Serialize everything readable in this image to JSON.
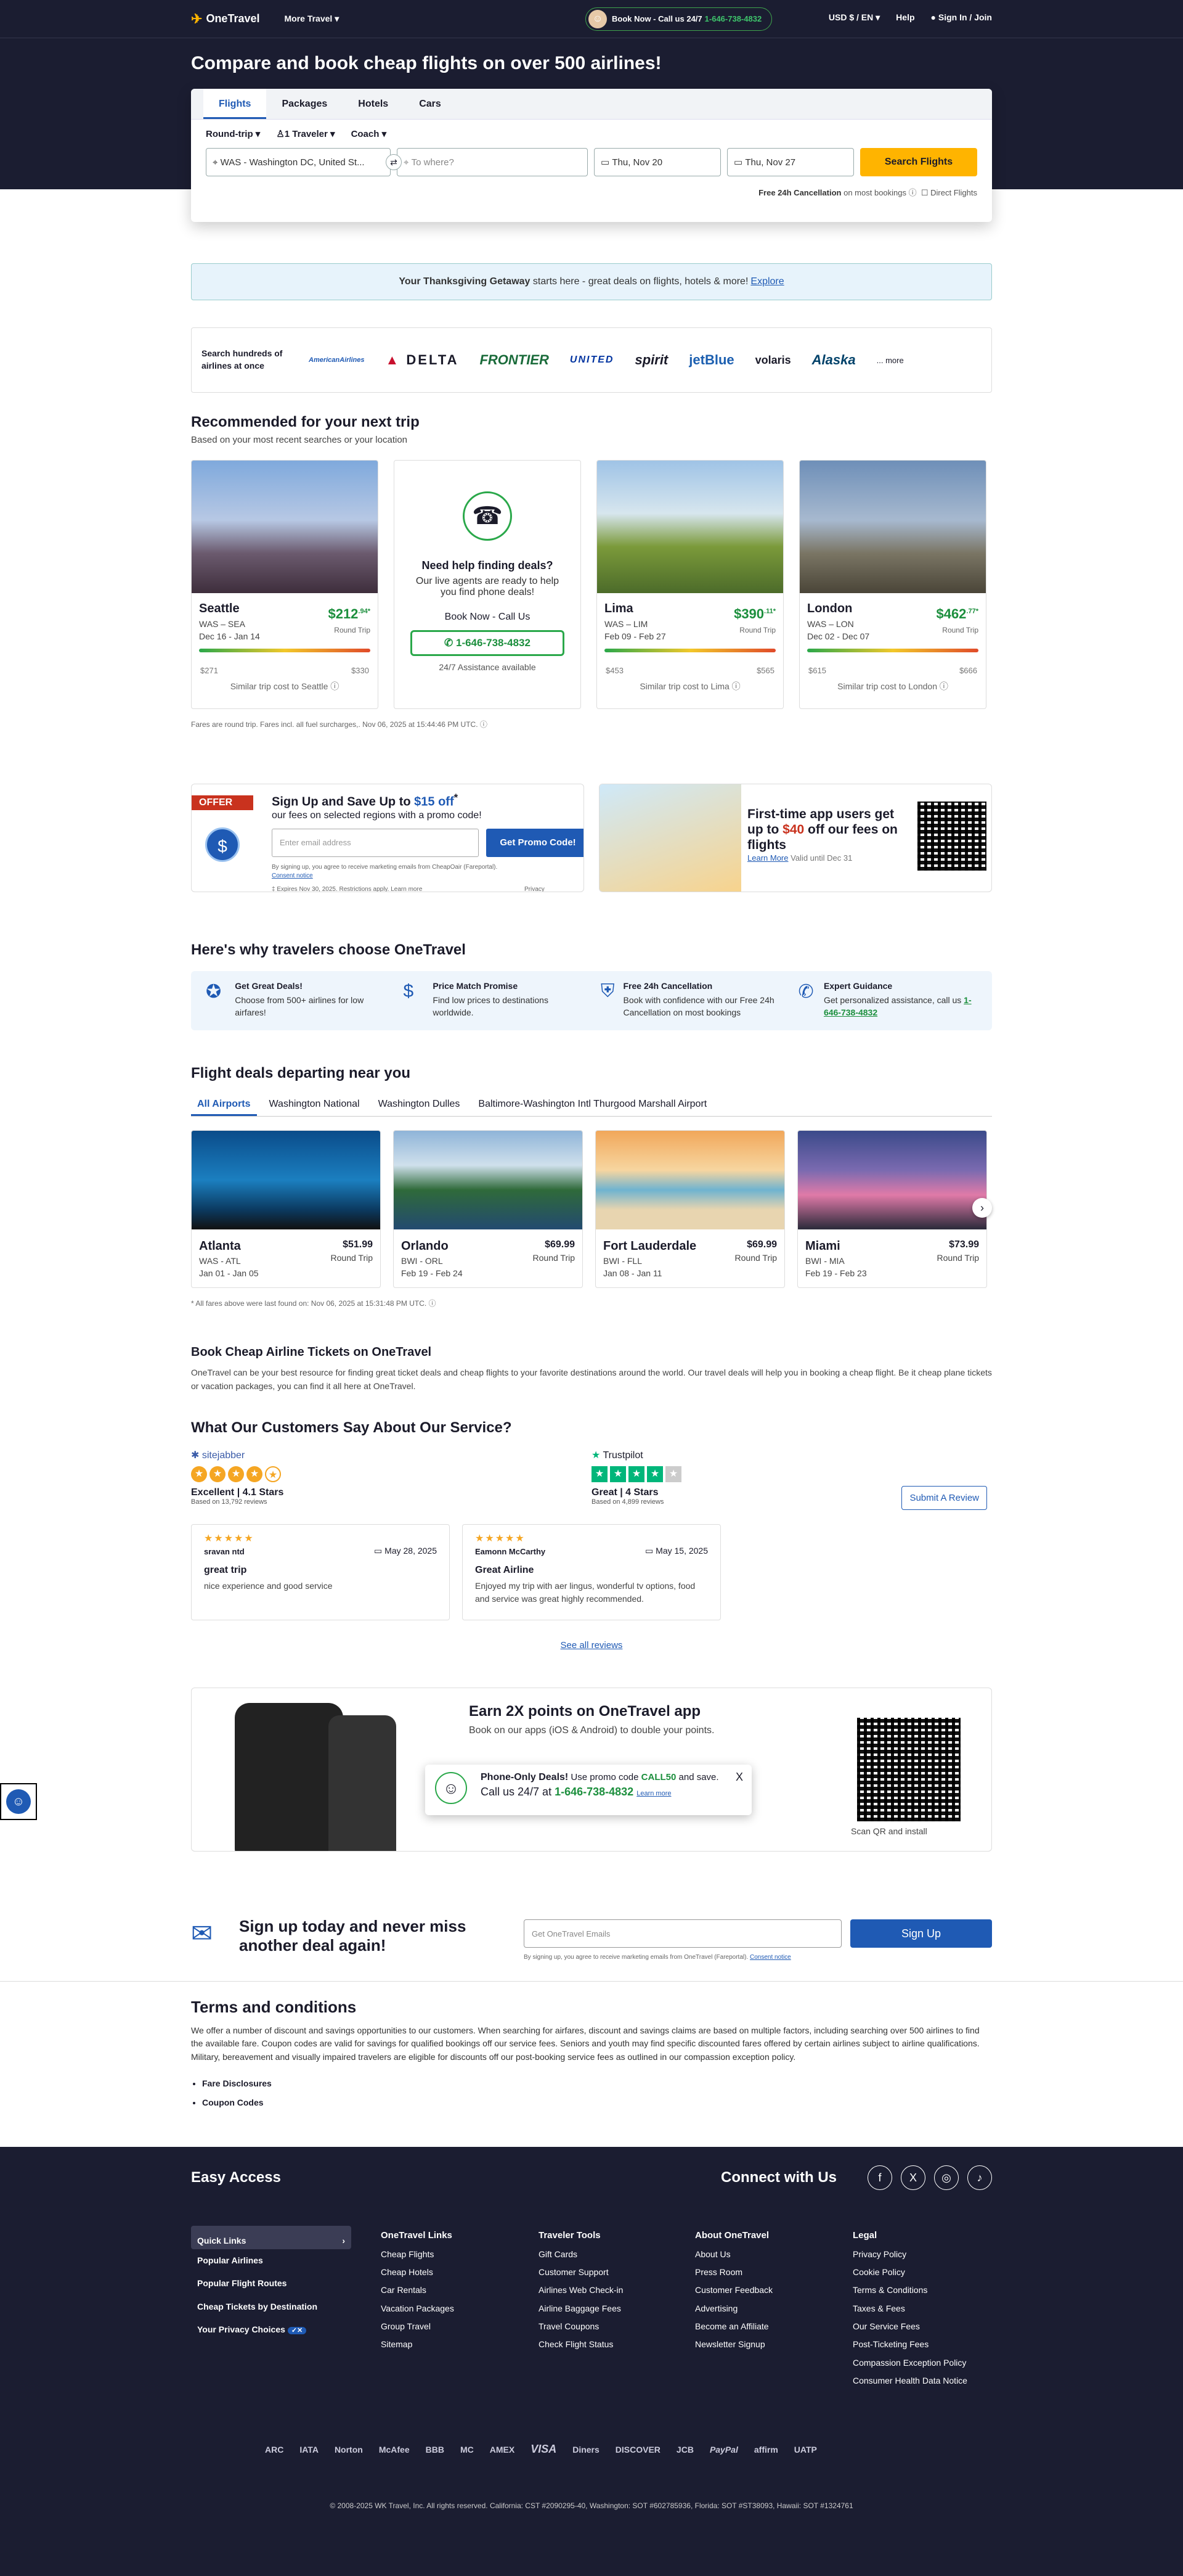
{
  "header": {
    "logo": "OneTravel",
    "more_travel": "More Travel ▾",
    "book_now": "Book Now - Call us 24/7",
    "phone": "1-646-738-4832",
    "currency": "USD $ / EN ▾",
    "help": "Help",
    "signin": "Sign In / Join"
  },
  "hero": {
    "title": "Compare and book cheap flights on over 500 airlines!"
  },
  "search": {
    "tabs": [
      "Flights",
      "Packages",
      "Hotels",
      "Cars"
    ],
    "trip_type": "Round-trip ▾",
    "travelers": "1 Traveler ▾",
    "cabin": "Coach ▾",
    "from": "WAS - Washington DC, United St...",
    "to_placeholder": "To where?",
    "depart": "Thu, Nov 20",
    "return": "Thu, Nov 27",
    "button": "Search Flights",
    "free_cancel_bold": "Free 24h Cancellation",
    "free_cancel_rest": "on most bookings ⓘ",
    "direct": "Direct Flights"
  },
  "banner": {
    "bold": "Your Thanksgiving Getaway",
    "rest": "starts here - great deals on flights, hotels & more!",
    "link": "Explore"
  },
  "airlines": {
    "label": "Search hundreds of airlines at once",
    "logos": [
      "AmericanAirlines",
      "DELTA",
      "FRONTIER",
      "UNITED",
      "spirit",
      "jetBlue",
      "volaris",
      "Alaska"
    ],
    "more": "... more"
  },
  "recommended": {
    "title": "Recommended for your next trip",
    "subtitle": "Based on your most recent searches or your location",
    "cards": [
      {
        "city": "Seattle",
        "price": "$212",
        "cents": ".94*",
        "route": "WAS – SEA",
        "dates": "Dec 16 - Jan 14",
        "low": "$271",
        "high": "$330",
        "similar": "Similar trip cost to Seattle ⓘ"
      },
      {
        "city": "Lima",
        "price": "$390",
        "cents": ".11*",
        "route": "WAS – LIM",
        "dates": "Feb 09 - Feb 27",
        "low": "$453",
        "high": "$565",
        "similar": "Similar trip cost to Lima ⓘ"
      },
      {
        "city": "London",
        "price": "$462",
        "cents": ".77*",
        "route": "WAS – LON",
        "dates": "Dec 02 - Dec 07",
        "low": "$615",
        "high": "$666",
        "similar": "Similar trip cost to London ⓘ"
      }
    ],
    "round_trip": "Round Trip",
    "help": {
      "title": "Need help finding deals?",
      "text": "Our live agents are ready to help you find phone deals!",
      "book": "Book Now - Call Us",
      "phone": "1-646-738-4832",
      "assist": "24/7 Assistance available"
    },
    "note": "Fares are round trip. Fares incl. all fuel surcharges,. Nov 06, 2025 at 15:44:46 PM UTC. ⓘ"
  },
  "promo": {
    "offer": "OFFER",
    "title": "Sign Up and Save Up to",
    "amount": "$15 off",
    "sup": "*",
    "sub": "our fees on selected regions with a promo code!",
    "email_placeholder": "Enter email address",
    "button": "Get Promo Code!",
    "fine1": "By signing up, you agree to receive marketing emails from CheapOair (Fareportal).",
    "consent": "Consent notice",
    "fine2": "‡ Expires Nov 30, 2025. Restrictions apply.",
    "learn": "Learn more",
    "privacy": "Privacy Policy"
  },
  "app_promo": {
    "title_a": "First-time app users get up to",
    "amount": "$40",
    "title_b": "off our fees on flights",
    "learn": "Learn More",
    "valid": "Valid until Dec 31"
  },
  "why": {
    "title": "Here's why travelers choose OneTravel",
    "items": [
      {
        "title": "Get Great Deals!",
        "text": "Choose from 500+ airlines for low airfares!"
      },
      {
        "title": "Price Match Promise",
        "text": "Find low prices to destinations worldwide."
      },
      {
        "title": "Free 24h Cancellation",
        "text": "Book with confidence with our Free 24h Cancellation on most bookings"
      },
      {
        "title": "Expert Guidance",
        "text": "Get personalized assistance, call us",
        "phone": "1-646-738-4832"
      }
    ]
  },
  "deals": {
    "title": "Flight deals departing near you",
    "tabs": [
      "All Airports",
      "Washington National",
      "Washington Dulles",
      "Baltimore-Washington Intl Thurgood Marshall Airport"
    ],
    "cards": [
      {
        "city": "Atlanta",
        "price": "$51.99",
        "route": "WAS - ATL",
        "dates": "Jan 01 - Jan 05"
      },
      {
        "city": "Orlando",
        "price": "$69.99",
        "route": "BWI - ORL",
        "dates": "Feb 19 - Feb 24"
      },
      {
        "city": "Fort Lauderdale",
        "price": "$69.99",
        "route": "BWI - FLL",
        "dates": "Jan 08 - Jan 11"
      },
      {
        "city": "Miami",
        "price": "$73.99",
        "route": "BWI - MIA",
        "dates": "Feb 19 - Feb 23"
      }
    ],
    "round_trip": "Round Trip",
    "note": "* All fares above were last found on: Nov 06, 2025 at 15:31:48 PM UTC. ⓘ"
  },
  "book_cheap": {
    "title": "Book Cheap Airline Tickets on OneTravel",
    "text": "OneTravel can be your best resource for finding great ticket deals and cheap flights to your favorite destinations around the world. Our travel deals will help you in booking a cheap flight. Be it cheap plane tickets or vacation packages, you can find it all here at OneTravel."
  },
  "reviews": {
    "title": "What Our Customers Say About Our Service?",
    "sitejabber": {
      "name": "sitejabber",
      "rating": "Excellent | 4.1 Stars",
      "count": "Based on 13,792 reviews"
    },
    "trustpilot": {
      "name": "Trustpilot",
      "rating": "Great | 4 Stars",
      "count": "Based on 4,899 reviews"
    },
    "submit": "Submit A Review",
    "items": [
      {
        "name": "sravan ntd",
        "date": "May 28, 2025",
        "title": "great trip",
        "body": "nice experience and good service"
      },
      {
        "name": "Eamonn McCarthy",
        "date": "May 15, 2025",
        "title": "Great Airline",
        "body": "Enjoyed my trip with aer lingus, wonderful tv options, food and service was great highly recommended."
      }
    ],
    "see_all": "See all reviews"
  },
  "earn": {
    "title": "Earn 2X points on OneTravel app",
    "sub": "Book on our apps (iOS & Android) to double your points.",
    "scan": "Scan QR and install",
    "toast": {
      "bold": "Phone-Only Deals!",
      "text": "Use promo code",
      "code": "CALL50",
      "text2": "and save.",
      "call": "Call us 24/7 at",
      "phone": "1-646-738-4832",
      "learn": "Learn more"
    }
  },
  "signup": {
    "title": "Sign up today and never miss another deal again!",
    "placeholder": "Get OneTravel Emails",
    "button": "Sign Up",
    "fine": "By signing up, you agree to receive marketing emails from OneTravel (Fareportal).",
    "consent": "Consent notice"
  },
  "terms": {
    "title": "Terms and conditions",
    "text": "We offer a number of discount and savings opportunities to our customers. When searching for airfares, discount and savings claims are based on multiple factors, including searching over 500 airlines to find the available fare. Coupon codes are valid for savings for qualified bookings off our service fees. Seniors and youth may find specific discounted fares offered by certain airlines subject to airline qualifications. Military, bereavement and visually impaired travelers are eligible for discounts off our post-booking service fees as outlined in our compassion exception policy.",
    "items": [
      "Fare Disclosures",
      "Coupon Codes"
    ]
  },
  "footer": {
    "easy": "Easy Access",
    "connect": "Connect with Us",
    "left": [
      "Quick Links",
      "Popular Airlines",
      "Popular Flight Routes",
      "Cheap Tickets by Destination",
      "Your Privacy Choices"
    ],
    "cols": [
      {
        "title": "OneTravel Links",
        "items": [
          "Cheap Flights",
          "Cheap Hotels",
          "Car Rentals",
          "Vacation Packages",
          "Group Travel",
          "Sitemap"
        ]
      },
      {
        "title": "Traveler Tools",
        "items": [
          "Gift Cards",
          "Customer Support",
          "Airlines Web Check-in",
          "Airline Baggage Fees",
          "Travel Coupons",
          "Check Flight Status"
        ]
      },
      {
        "title": "About OneTravel",
        "items": [
          "About Us",
          "Press Room",
          "Customer Feedback",
          "Advertising",
          "Become an Affiliate",
          "Newsletter Signup"
        ]
      },
      {
        "title": "Legal",
        "items": [
          "Privacy Policy",
          "Cookie Policy",
          "Terms & Conditions",
          "Taxes & Fees",
          "Our Service Fees",
          "Post-Ticketing Fees",
          "Compassion Exception Policy",
          "Consumer Health Data Notice"
        ]
      }
    ],
    "payments": [
      "ARC",
      "IATA",
      "Norton",
      "McAfee",
      "BBB",
      "MC",
      "AMEX",
      "VISA",
      "Diners",
      "DISCOVER",
      "JCB",
      "PayPal",
      "affirm",
      "UATP"
    ],
    "copyright": "© 2008-2025 WK Travel, Inc. All rights reserved. California: CST #2090295-40, Washington: SOT #602785936, Florida: SOT #ST38093, Hawaii: SOT #1324761"
  }
}
